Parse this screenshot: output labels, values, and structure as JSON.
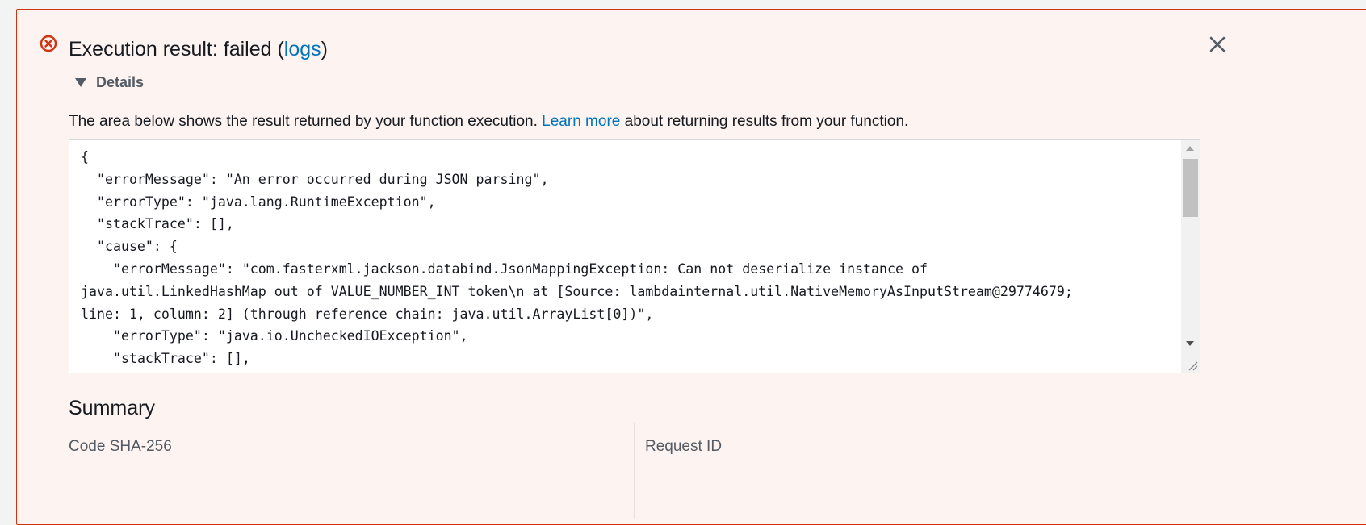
{
  "header": {
    "title_prefix": "Execution result: failed (",
    "logs_link": "logs",
    "title_suffix": ")"
  },
  "details": {
    "toggle_label": "Details",
    "description_prefix": "The area below shows the result returned by your function execution. ",
    "learn_more_link": "Learn more",
    "description_suffix": " about returning results from your function.",
    "result_text": "{\n  \"errorMessage\": \"An error occurred during JSON parsing\",\n  \"errorType\": \"java.lang.RuntimeException\",\n  \"stackTrace\": [],\n  \"cause\": {\n    \"errorMessage\": \"com.fasterxml.jackson.databind.JsonMappingException: Can not deserialize instance of\njava.util.LinkedHashMap out of VALUE_NUMBER_INT token\\n at [Source: lambdainternal.util.NativeMemoryAsInputStream@29774679;\nline: 1, column: 2] (through reference chain: java.util.ArrayList[0])\",\n    \"errorType\": \"java.io.UncheckedIOException\",\n    \"stackTrace\": [],\n    \"cause\": {"
  },
  "summary": {
    "title": "Summary",
    "code_sha_label": "Code SHA-256",
    "request_id_label": "Request ID"
  },
  "colors": {
    "error": "#d13212",
    "link": "#0073bb",
    "panel_background": "#fdf3f1"
  },
  "icons": {
    "status": "error-circle-icon",
    "close": "close-icon",
    "toggle": "caret-down-icon"
  }
}
